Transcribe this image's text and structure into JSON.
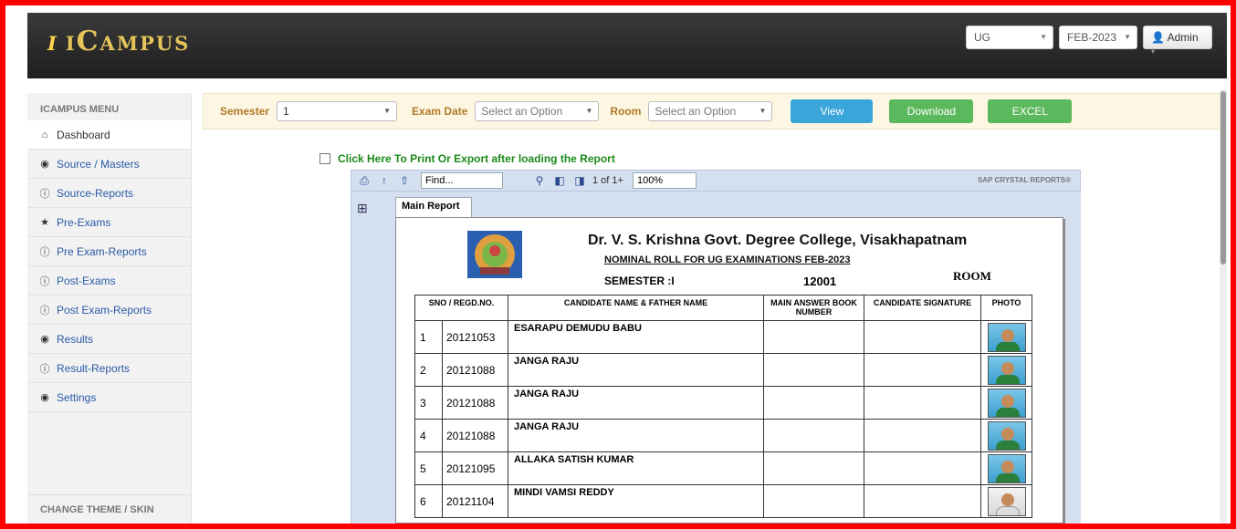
{
  "app": {
    "logo_i": "i",
    "logo_text": "iCampus"
  },
  "navbar": {
    "program": "UG",
    "exam_session": "FEB-2023",
    "user": "Admin"
  },
  "sidebar": {
    "header": "ICAMPUS MENU",
    "items": [
      {
        "label": "Dashboard",
        "icon": "home-icon",
        "glyph": "⌂"
      },
      {
        "label": "Source / Masters",
        "icon": "eye-icon",
        "glyph": "◉"
      },
      {
        "label": "Source-Reports",
        "icon": "info-icon",
        "glyph": "ⓘ"
      },
      {
        "label": "Pre-Exams",
        "icon": "star-icon",
        "glyph": "★"
      },
      {
        "label": "Pre Exam-Reports",
        "icon": "info-icon",
        "glyph": "ⓘ"
      },
      {
        "label": "Post-Exams",
        "icon": "info-icon",
        "glyph": "ⓘ"
      },
      {
        "label": "Post Exam-Reports",
        "icon": "info-icon",
        "glyph": "ⓘ"
      },
      {
        "label": "Results",
        "icon": "eye-icon",
        "glyph": "◉"
      },
      {
        "label": "Result-Reports",
        "icon": "info-icon",
        "glyph": "ⓘ"
      },
      {
        "label": "Settings",
        "icon": "eye-icon",
        "glyph": "◉"
      }
    ],
    "footer": "CHANGE THEME / SKIN"
  },
  "filter": {
    "semester_label": "Semester",
    "semester_value": "1",
    "exam_date_label": "Exam Date",
    "exam_date_value": "Select an Option",
    "room_label": "Room",
    "room_value": "Select an Option",
    "view_label": "View",
    "download_label": "Download",
    "excel_label": "EXCEL"
  },
  "export_text": "Click Here To Print Or Export after loading the Report",
  "viewer": {
    "find_placeholder": "Find...",
    "page_info": "1 of 1+",
    "zoom": "100%",
    "brand": "SAP CRYSTAL REPORTS®",
    "tab": "Main Report"
  },
  "report": {
    "college": "Dr. V. S. Krishna Govt. Degree College, Visakhapatnam",
    "nominal": "NOMINAL ROLL FOR UG EXAMINATIONS FEB-2023",
    "semester": "SEMESTER :I",
    "room_no": "12001",
    "room_label": "ROOM",
    "headers": [
      "SNO / REGD.NO.",
      "CANDIDATE NAME & FATHER NAME",
      "MAIN ANSWER BOOK NUMBER",
      "CANDIDATE SIGNATURE",
      "PHOTO"
    ],
    "rows": [
      {
        "sno": "1",
        "regd": "20121053",
        "name": "ESARAPU DEMUDU BABU"
      },
      {
        "sno": "2",
        "regd": "20121088",
        "name": "JANGA RAJU"
      },
      {
        "sno": "3",
        "regd": "20121088",
        "name": "JANGA RAJU"
      },
      {
        "sno": "4",
        "regd": "20121088",
        "name": "JANGA RAJU"
      },
      {
        "sno": "5",
        "regd": "20121095",
        "name": "ALLAKA SATISH KUMAR"
      },
      {
        "sno": "6",
        "regd": "20121104",
        "name": "MINDI VAMSI REDDY"
      }
    ]
  }
}
